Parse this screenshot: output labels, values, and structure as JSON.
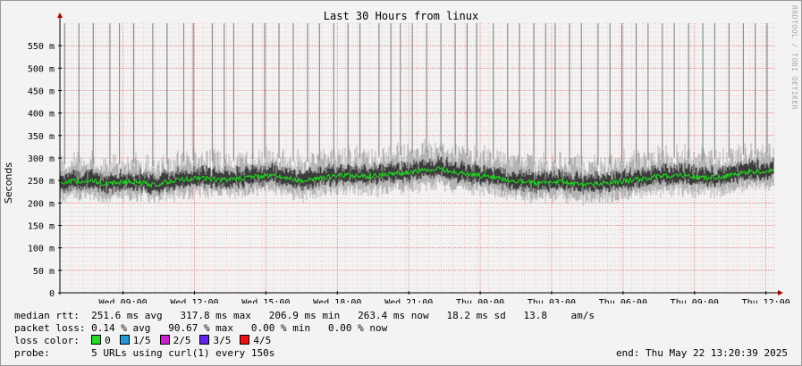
{
  "chart_data": {
    "type": "area",
    "title": "Last 30 Hours from linux",
    "ylabel": "Seconds",
    "ylim": [
      0,
      0.6
    ],
    "yticks": [
      {
        "v": 0,
        "label": "0"
      },
      {
        "v": 0.05,
        "label": "50 m"
      },
      {
        "v": 0.1,
        "label": "100 m"
      },
      {
        "v": 0.15,
        "label": "150 m"
      },
      {
        "v": 0.2,
        "label": "200 m"
      },
      {
        "v": 0.25,
        "label": "250 m"
      },
      {
        "v": 0.3,
        "label": "300 m"
      },
      {
        "v": 0.35,
        "label": "350 m"
      },
      {
        "v": 0.4,
        "label": "400 m"
      },
      {
        "v": 0.45,
        "label": "450 m"
      },
      {
        "v": 0.5,
        "label": "500 m"
      },
      {
        "v": 0.55,
        "label": "550 m"
      }
    ],
    "xlim_hours": [
      -30,
      0
    ],
    "xticks": [
      {
        "h": -27.35,
        "label": "Wed 09:00"
      },
      {
        "h": -24.35,
        "label": "Wed 12:00"
      },
      {
        "h": -21.35,
        "label": "Wed 15:00"
      },
      {
        "h": -18.35,
        "label": "Wed 18:00"
      },
      {
        "h": -15.35,
        "label": "Wed 21:00"
      },
      {
        "h": -12.35,
        "label": "Thu 00:00"
      },
      {
        "h": -9.35,
        "label": "Thu 03:00"
      },
      {
        "h": -6.35,
        "label": "Thu 06:00"
      },
      {
        "h": -3.35,
        "label": "Thu 09:00"
      },
      {
        "h": -0.35,
        "label": "Thu 12:00"
      }
    ],
    "median_rtt": [
      [
        -30,
        0.245
      ],
      [
        -29,
        0.25
      ],
      [
        -28,
        0.243
      ],
      [
        -27,
        0.248
      ],
      [
        -26,
        0.24
      ],
      [
        -25,
        0.252
      ],
      [
        -24,
        0.255
      ],
      [
        -23,
        0.25
      ],
      [
        -22,
        0.258
      ],
      [
        -21,
        0.262
      ],
      [
        -20,
        0.25
      ],
      [
        -19,
        0.255
      ],
      [
        -18,
        0.262
      ],
      [
        -17,
        0.26
      ],
      [
        -16,
        0.265
      ],
      [
        -15,
        0.27
      ],
      [
        -14,
        0.275
      ],
      [
        -13,
        0.265
      ],
      [
        -12,
        0.26
      ],
      [
        -11,
        0.25
      ],
      [
        -10,
        0.245
      ],
      [
        -9,
        0.248
      ],
      [
        -8,
        0.24
      ],
      [
        -7,
        0.245
      ],
      [
        -6,
        0.25
      ],
      [
        -5,
        0.258
      ],
      [
        -4,
        0.262
      ],
      [
        -3,
        0.255
      ],
      [
        -2,
        0.26
      ],
      [
        -1,
        0.27
      ],
      [
        0,
        0.27
      ]
    ],
    "series": [
      {
        "name": "median rtt",
        "color": "#22dd22"
      }
    ],
    "spike_hours": [
      -29.8,
      -29.2,
      -28.6,
      -27.9,
      -27.5,
      -26.9,
      -26.1,
      -25.5,
      -24.8,
      -24.4,
      -23.6,
      -23.1,
      -22.7,
      -21.9,
      -21.4,
      -20.8,
      -20.2,
      -19.6,
      -19.1,
      -18.5,
      -17.9,
      -17.4,
      -16.6,
      -16.1,
      -15.7,
      -15.2,
      -14.6,
      -14.0,
      -13.4,
      -12.9,
      -12.5,
      -11.8,
      -11.2,
      -10.7,
      -10.1,
      -9.6,
      -9.2,
      -8.6,
      -8.1,
      -7.4,
      -6.9,
      -6.4,
      -5.8,
      -5.3,
      -4.7,
      -4.2,
      -3.6,
      -3.0,
      -2.5,
      -1.9,
      -1.3,
      -0.8,
      -0.3
    ],
    "colors": {
      "grid_minor": "#f0b0b0",
      "grid_major": "#e08080",
      "smoke_outer": "#b4b4b4",
      "smoke_inner": "#3c3c3c",
      "axis": "#000000",
      "arrow": "#aa0000"
    }
  },
  "stats": {
    "rtt_label": "median rtt:",
    "rtt_values": "251.6 ms avg   317.8 ms max   206.9 ms min   263.4 ms now   18.2 ms sd   13.8    am/s",
    "loss_label": "packet loss:",
    "loss_values": "0.14 % avg   90.67 % max   0.00 % min   0.00 % now",
    "color_label": "loss color:",
    "loss_colors": [
      {
        "label": "0",
        "color": "#22dd22"
      },
      {
        "label": "1/5",
        "color": "#2299dd"
      },
      {
        "label": "2/5",
        "color": "#cc22cc"
      },
      {
        "label": "3/5",
        "color": "#6622ee"
      },
      {
        "label": "4/5",
        "color": "#ee1111"
      }
    ],
    "probe_label": "probe:",
    "probe_value": "5 URLs using curl(1) every 150s",
    "end": "end: Thu May 22 13:20:39 2025"
  },
  "side_text": "RRDTOOL / TOBI OETIKER"
}
